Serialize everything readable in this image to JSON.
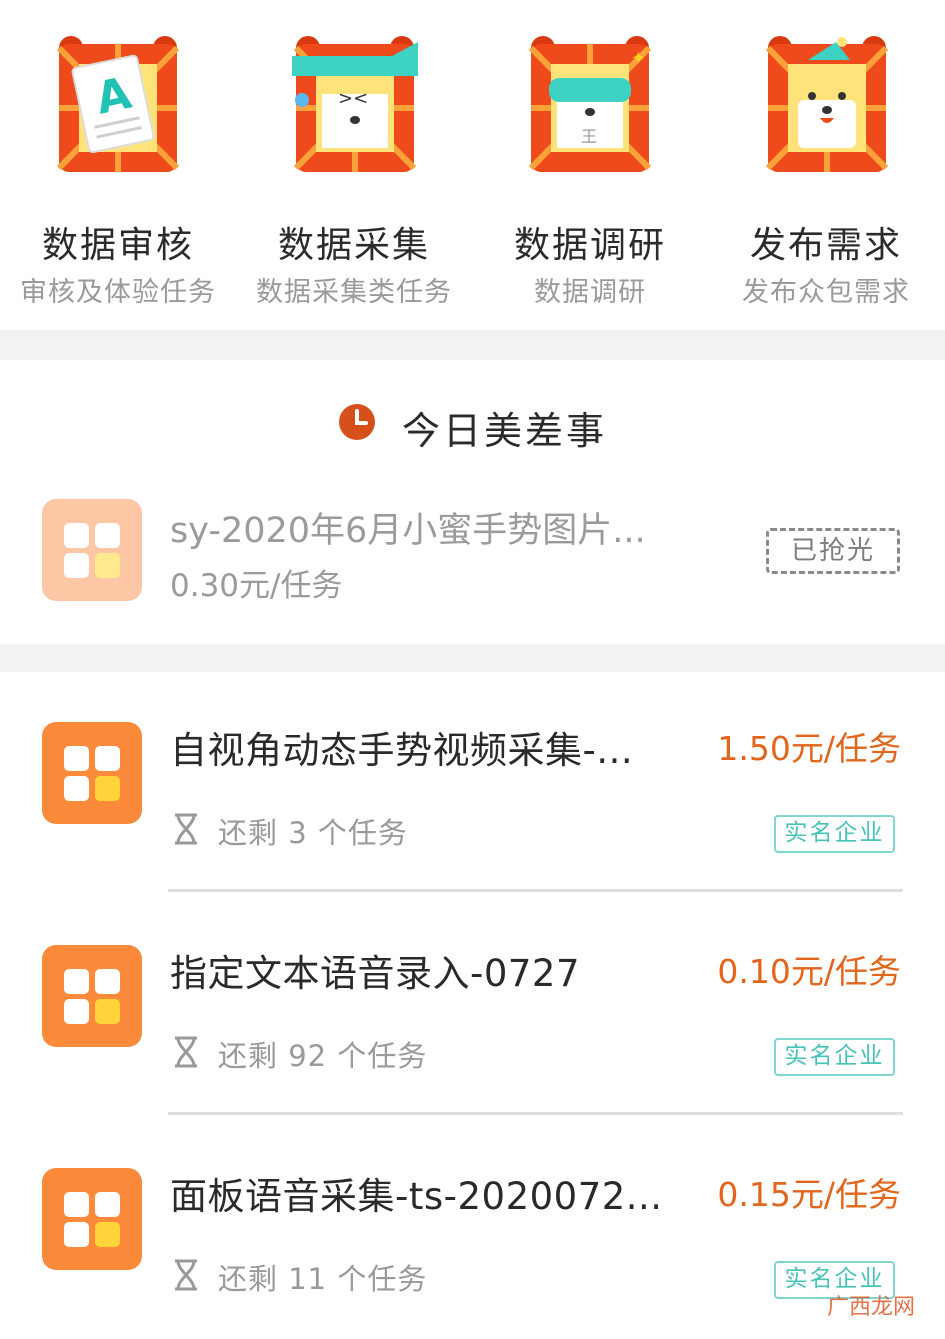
{
  "categories": [
    {
      "title": "数据审核",
      "subtitle": "审核及体验任务",
      "icon": "review-tiger-icon"
    },
    {
      "title": "数据采集",
      "subtitle": "数据采集类任务",
      "icon": "collect-tiger-icon"
    },
    {
      "title": "数据调研",
      "subtitle": "数据调研",
      "icon": "survey-tiger-icon"
    },
    {
      "title": "发布需求",
      "subtitle": "发布众包需求",
      "icon": "publish-tiger-icon"
    }
  ],
  "today": {
    "title": "今日美差事",
    "item": {
      "title": "sy-2020年6月小蜜手势图片...",
      "price": "0.30元/任务",
      "status": "已抢光"
    }
  },
  "tasks": [
    {
      "title": "自视角动态手势视频采集-...",
      "price": "1.50元/任务",
      "remaining": "还剩 3 个任务",
      "badge": "实名企业"
    },
    {
      "title": "指定文本语音录入-0727",
      "price": "0.10元/任务",
      "remaining": "还剩 92 个任务",
      "badge": "实名企业"
    },
    {
      "title": "面板语音采集-ts-2020072...",
      "price": "0.15元/任务",
      "remaining": "还剩 11 个任务",
      "badge": "实名企业"
    }
  ],
  "watermark": "广西龙网",
  "colors": {
    "accent": "#e2661b",
    "task_icon": "#fb8b3a",
    "task_icon_faded": "#fdc7a6",
    "badge": "#47c3b8",
    "tiger_frame": "#ee4a1c",
    "tiger_face": "#fde37a"
  }
}
